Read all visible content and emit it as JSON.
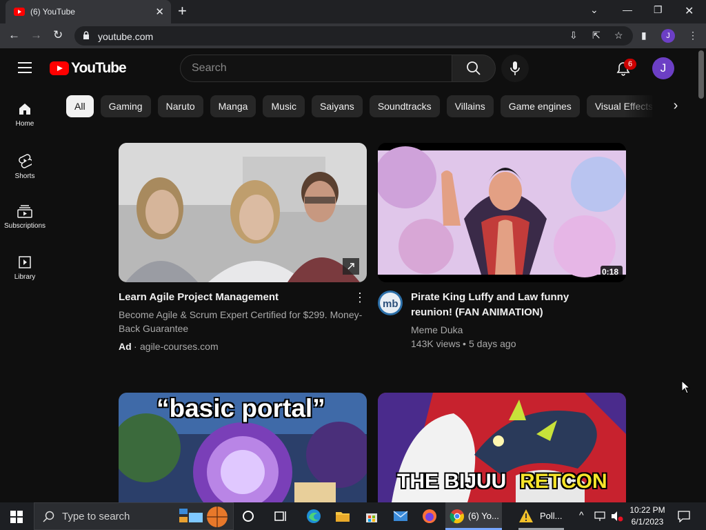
{
  "browser": {
    "tab_title": "(6) YouTube",
    "url": "youtube.com",
    "profile_initial": "J"
  },
  "header": {
    "logo_text": "YouTube",
    "search_placeholder": "Search",
    "notification_count": "6",
    "avatar_initial": "J"
  },
  "sidebar": {
    "items": [
      {
        "label": "Home",
        "icon": "home-icon"
      },
      {
        "label": "Shorts",
        "icon": "shorts-icon"
      },
      {
        "label": "Subscriptions",
        "icon": "subscriptions-icon"
      },
      {
        "label": "Library",
        "icon": "library-icon"
      }
    ]
  },
  "chips": [
    "All",
    "Gaming",
    "Naruto",
    "Manga",
    "Music",
    "Saiyans",
    "Soundtracks",
    "Villains",
    "Game engines",
    "Visual Effects"
  ],
  "videos": [
    {
      "title": "Learn Agile Project Management",
      "description": "Become Agile & Scrum Expert Certified for $299. Money-Back Guarantee",
      "ad_label": "Ad",
      "domain": "agile-courses.com"
    },
    {
      "title": "Pirate King Luffy and Law funny reunion! (FAN ANIMATION)",
      "channel": "Meme Duka",
      "views": "143K views",
      "age": "5 days ago",
      "duration": "0:18"
    },
    {
      "thumb_text": "“basic portal”"
    },
    {
      "thumb_text_1": "THE BIJUU",
      "thumb_text_2": "RETCON"
    }
  ],
  "taskbar": {
    "search_placeholder": "Type to search",
    "chrome_label": "(6) Yo...",
    "poll_label": "Poll...",
    "time": "10:22 PM",
    "date": "6/1/2023"
  },
  "colors": {
    "accent_red": "#ff0000",
    "avatar_purple": "#6c3fc5",
    "background": "#0f0f0f"
  }
}
